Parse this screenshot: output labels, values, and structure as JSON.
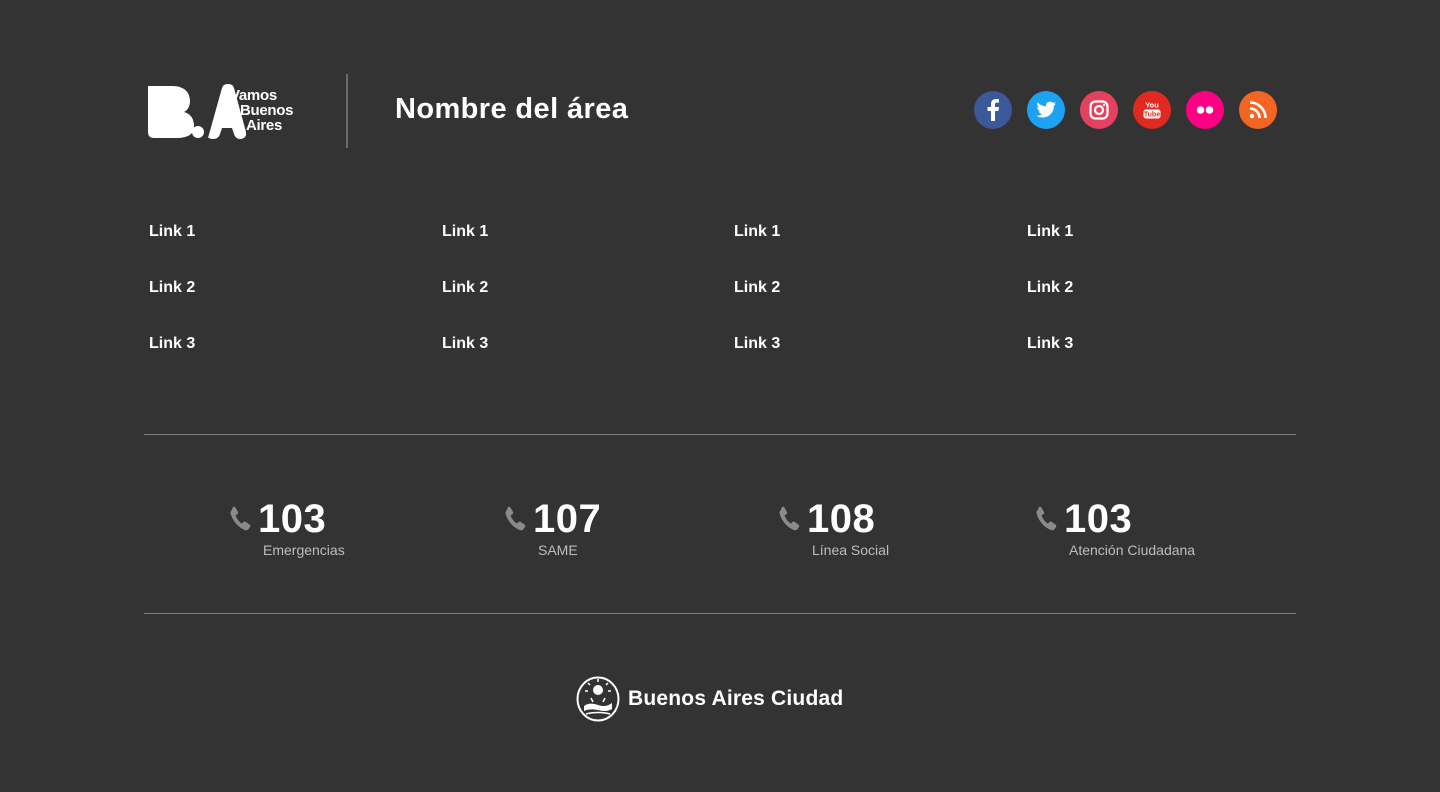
{
  "header": {
    "brand_lines": [
      "Vamos",
      "Buenos",
      "Aires"
    ],
    "area_title": "Nombre del área"
  },
  "social": [
    {
      "name": "facebook-icon",
      "color": "#3b5998"
    },
    {
      "name": "twitter-icon",
      "color": "#1da1f2"
    },
    {
      "name": "instagram-icon",
      "color": "#e4405f"
    },
    {
      "name": "youtube-icon",
      "color": "#e02a20"
    },
    {
      "name": "flickr-icon",
      "color": "#ff0084"
    },
    {
      "name": "rss-icon",
      "color": "#f26522"
    }
  ],
  "links": {
    "columns": [
      [
        "Link 1",
        "Link 2",
        "Link 3"
      ],
      [
        "Link 1",
        "Link 2",
        "Link 3"
      ],
      [
        "Link 1",
        "Link 2",
        "Link 3"
      ],
      [
        "Link 1",
        "Link 2",
        "Link 3"
      ]
    ]
  },
  "phones": [
    {
      "number": "103",
      "label": "Emergencias"
    },
    {
      "number": "107",
      "label": "SAME"
    },
    {
      "number": "108",
      "label": "Línea Social"
    },
    {
      "number": "103",
      "label": "Atención Ciudadana"
    }
  ],
  "city": {
    "name": "Buenos Aires Ciudad"
  },
  "colors": {
    "background": "#333333",
    "text": "#ffffff",
    "muted": "#bdbdbd",
    "divider": "#7b7b7b"
  }
}
